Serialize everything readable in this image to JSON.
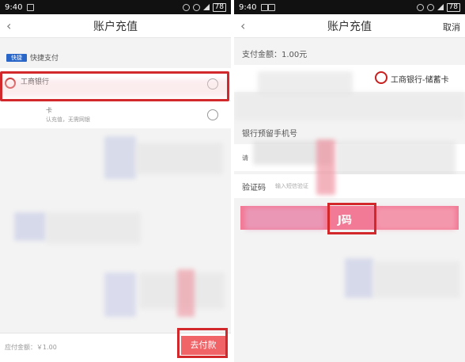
{
  "left": {
    "status": {
      "time": "9:40",
      "battery": "78"
    },
    "nav": {
      "back": "‹",
      "title": "账户充值"
    },
    "section_label": "快捷支付",
    "quick_logo": "快捷",
    "bank_name": "工商银行",
    "row2_text": "卡",
    "row2_sub": "认充值，无需网银",
    "bottom_amount": "应付金额：￥1.00",
    "pay_button": "去付款"
  },
  "right": {
    "status": {
      "time": "9:40",
      "battery": "78"
    },
    "nav": {
      "back": "‹",
      "title": "账户充值",
      "cancel": "取消"
    },
    "amount_label": "支付金额：1.00元",
    "card_name": "工商银行-储蓄卡",
    "phone_label": "银行预留手机号",
    "phone_placeholder": "请",
    "code_label": "验证码",
    "code_hint": "输入短信验证",
    "code_button_fragment": "J码"
  },
  "colors": {
    "highlight": "#d2282b",
    "pay": "#f06468",
    "confirm": "#f27a96",
    "icbc": "#c81e1e"
  }
}
